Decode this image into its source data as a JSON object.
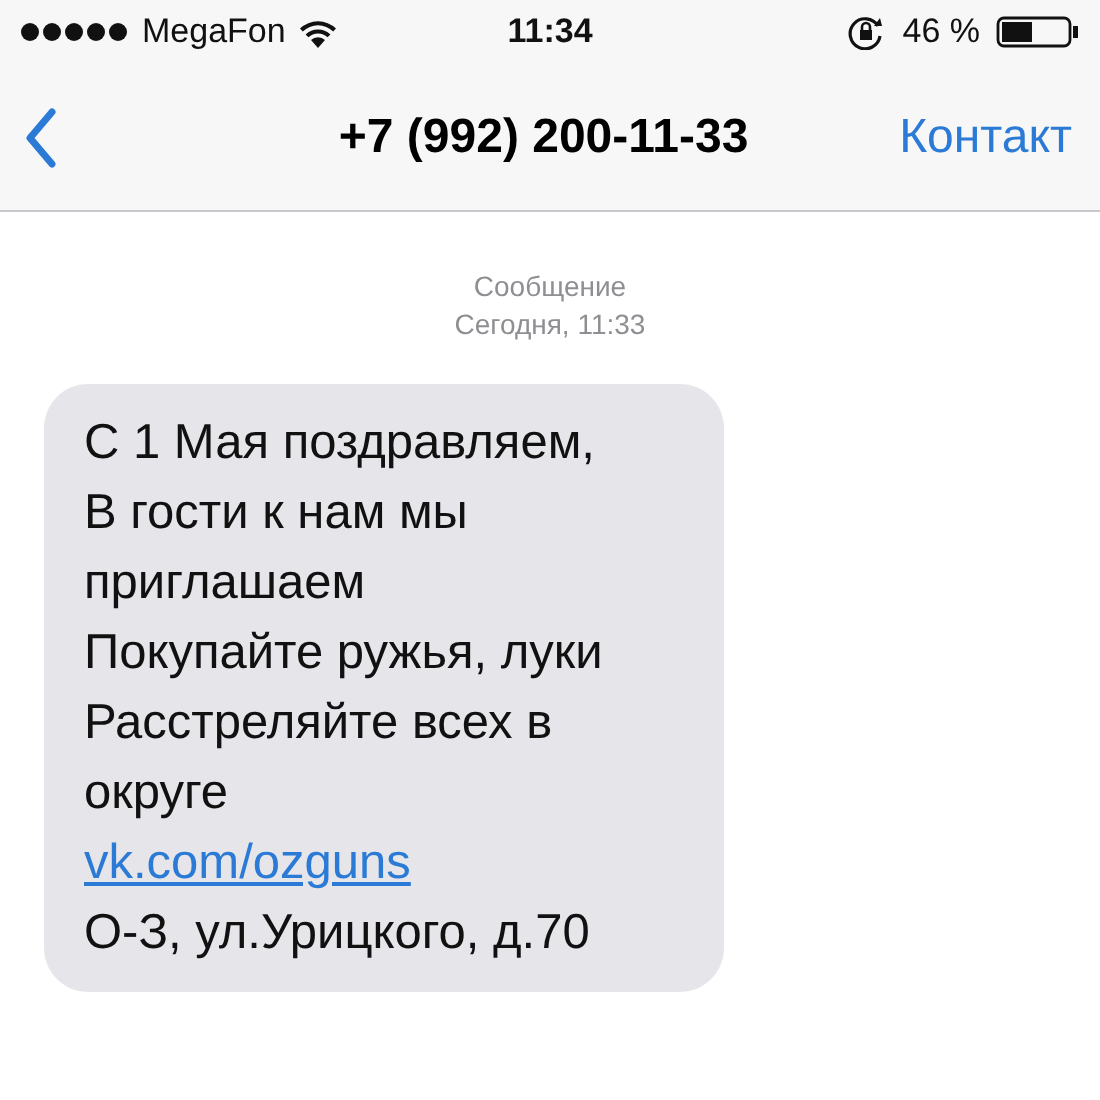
{
  "status_bar": {
    "carrier": "MegaFon",
    "time": "11:34",
    "battery": "46 %"
  },
  "nav_bar": {
    "title": "+7 (992) 200-11-33",
    "right_button": "Контакт"
  },
  "header": {
    "label": "Сообщение",
    "timestamp": "Сегодня, 11:33"
  },
  "message": {
    "lines": [
      {
        "kind": "text",
        "text": "С 1 Мая поздравляем,"
      },
      {
        "kind": "text",
        "text": "В гости к нам мы"
      },
      {
        "kind": "text",
        "text": "приглашаем"
      },
      {
        "kind": "text",
        "text": "Покупайте ружья, луки"
      },
      {
        "kind": "text",
        "text": "Расстреляйте всех в"
      },
      {
        "kind": "text",
        "text": "округе"
      },
      {
        "kind": "link",
        "text": "vk.com/ozguns"
      },
      {
        "kind": "text",
        "text": "О-З, ул.Урицкого, д.70"
      }
    ]
  }
}
